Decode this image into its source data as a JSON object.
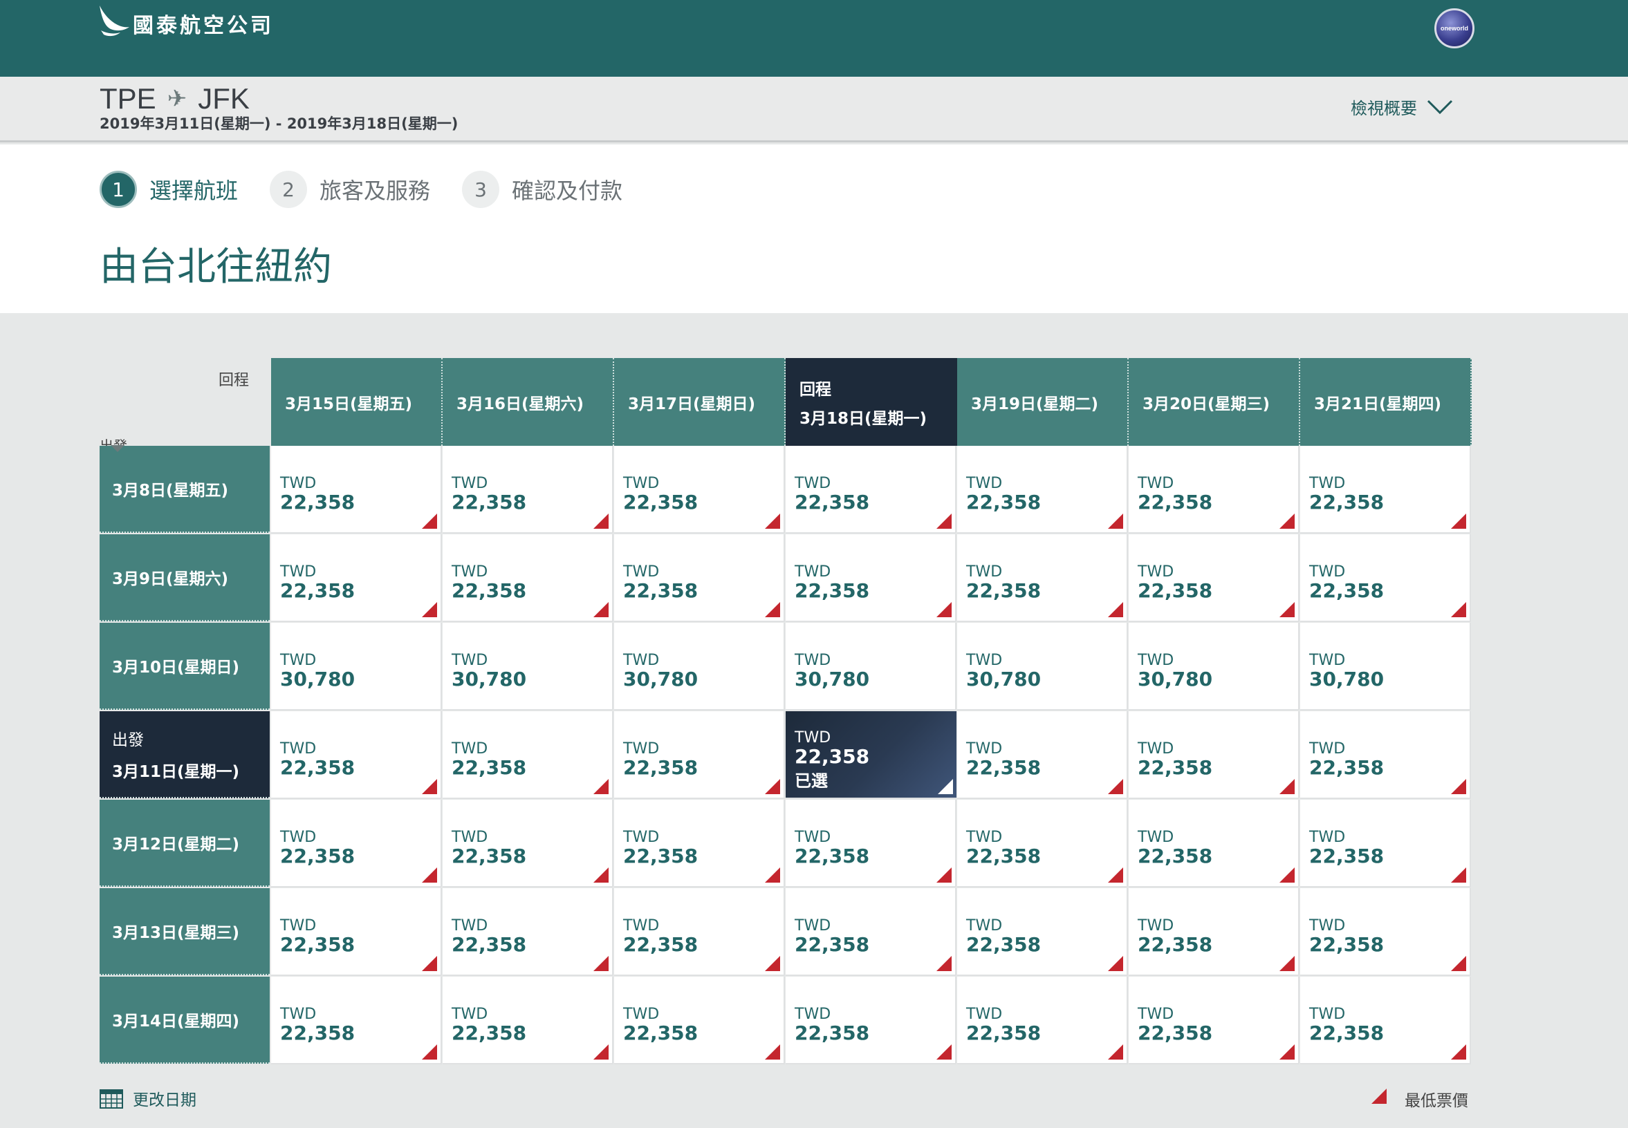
{
  "brand": {
    "name": "國泰航空公司",
    "alliance": "oneworld"
  },
  "route": {
    "origin": "TPE",
    "destination": "JFK",
    "dates": "2019年3月11日(星期一) - 2019年3月18日(星期一)",
    "summary_label": "檢視概要"
  },
  "steps": [
    {
      "num": "1",
      "label": "選擇航班"
    },
    {
      "num": "2",
      "label": "旅客及服務"
    },
    {
      "num": "3",
      "label": "確認及付款"
    }
  ],
  "page_title": "由台北往紐約",
  "grid": {
    "return_label": "回程",
    "depart_label": "出發",
    "columns": [
      "3月15日(星期五)",
      "3月16日(星期六)",
      "3月17日(星期日)",
      "3月18日(星期一)",
      "3月19日(星期二)",
      "3月20日(星期三)",
      "3月21日(星期四)"
    ],
    "rows": [
      "3月8日(星期五)",
      "3月9日(星期六)",
      "3月10日(星期日)",
      "3月11日(星期一)",
      "3月12日(星期二)",
      "3月13日(星期三)",
      "3月14日(星期四)"
    ],
    "selected_row": 3,
    "selected_col": 3,
    "currency": "TWD",
    "selected_tag": "已選",
    "row_prices": [
      "22,358",
      "22,358",
      "30,780",
      "22,358",
      "22,358",
      "22,358",
      "22,358"
    ],
    "row_lowest": [
      true,
      true,
      false,
      true,
      true,
      true,
      true
    ]
  },
  "footer": {
    "change_dates": "更改日期",
    "lowest_fare": "最低票價"
  }
}
